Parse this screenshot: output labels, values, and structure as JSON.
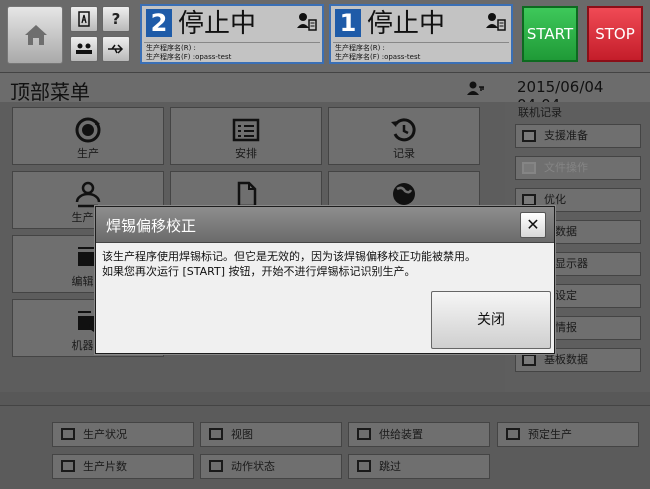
{
  "topbar": {
    "home_icon": "home-icon",
    "help_label": "?",
    "lanes": [
      {
        "number": "2",
        "status": "停止中",
        "line1": "生产程序名(R) :",
        "line2": "生产程序名(F) :opass-test"
      },
      {
        "number": "1",
        "status": "停止中",
        "line1": "生产程序名(R) :",
        "line2": "生产程序名(F) :opass-test"
      }
    ],
    "start_label": "START",
    "stop_label": "STOP"
  },
  "header": {
    "title": "顶部菜单",
    "datetime": "2015/06/04 04:04"
  },
  "main": {
    "tiles": [
      {
        "label": "生产"
      },
      {
        "label": "安排"
      },
      {
        "label": "记录"
      },
      {
        "label": "生产袖"
      },
      {
        "label": ""
      },
      {
        "label": ""
      },
      {
        "label": "编辑数"
      },
      {
        "label": "机器设"
      }
    ]
  },
  "right_panel": {
    "section_title": "联机记录",
    "items": [
      {
        "label": "支援准备"
      },
      {
        "label": "文件操作"
      },
      {
        "label": "优化"
      },
      {
        "label": "片数据"
      },
      {
        "label": "板显示器"
      },
      {
        "label": "能设定"
      },
      {
        "label": "器情报"
      },
      {
        "label": "基板数据"
      }
    ]
  },
  "bottom_nav": {
    "items": [
      {
        "label": "生产状况"
      },
      {
        "label": "视图"
      },
      {
        "label": "供给装置"
      },
      {
        "label": "预定生产"
      },
      {
        "label": "生产片数"
      },
      {
        "label": "动作状态"
      },
      {
        "label": "跳过"
      }
    ]
  },
  "dialog": {
    "title": "焊锡偏移校正",
    "close_symbol": "✕",
    "message_line1": "该生产程序使用焊锡标记。但它是无效的，因为该焊锡偏移校正功能被禁用。",
    "message_line2": "如果您再次运行 [START] 按钮，开始不进行焊锡标记识别生产。",
    "ok_label": "关闭"
  },
  "colors": {
    "accent_blue": "#1e5ba8",
    "start_green": "#2fb149",
    "stop_red": "#e23240",
    "panel_gray": "#6f6f6f"
  }
}
